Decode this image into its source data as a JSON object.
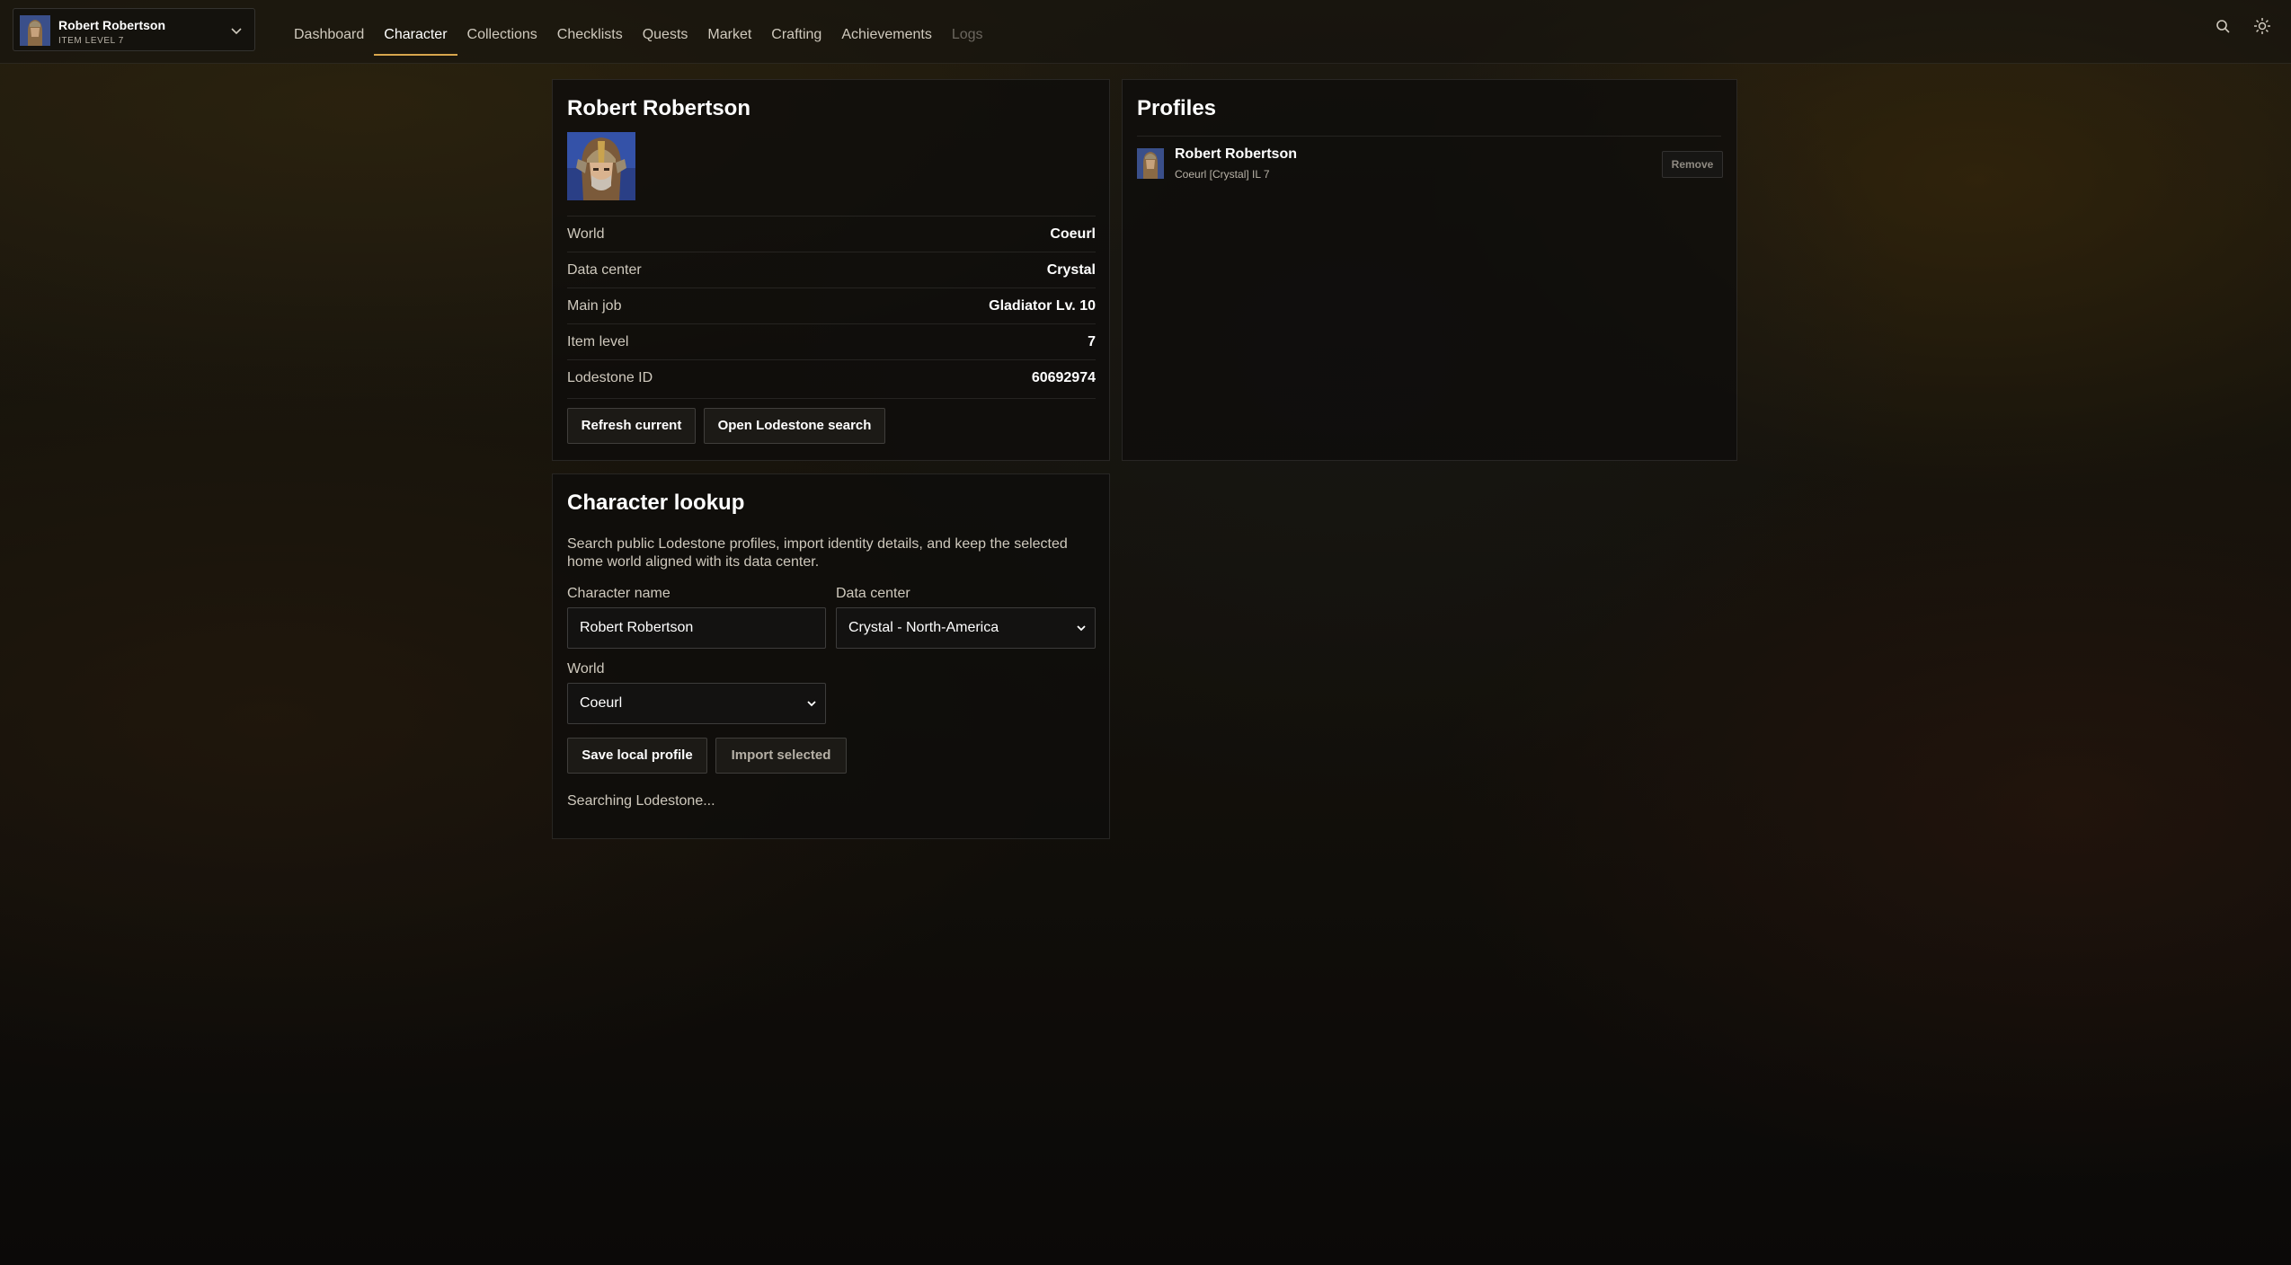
{
  "header": {
    "character_name": "Robert Robertson",
    "item_level_label": "ITEM LEVEL 7",
    "nav": [
      {
        "label": "Dashboard",
        "state": "normal"
      },
      {
        "label": "Character",
        "state": "active"
      },
      {
        "label": "Collections",
        "state": "normal"
      },
      {
        "label": "Checklists",
        "state": "normal"
      },
      {
        "label": "Quests",
        "state": "normal"
      },
      {
        "label": "Market",
        "state": "normal"
      },
      {
        "label": "Crafting",
        "state": "normal"
      },
      {
        "label": "Achievements",
        "state": "normal"
      },
      {
        "label": "Logs",
        "state": "disabled"
      }
    ],
    "icons": [
      "chevron-down-icon",
      "search-icon",
      "theme-sun-icon"
    ]
  },
  "character_card": {
    "title": "Robert Robertson",
    "details": [
      {
        "label": "World",
        "value": "Coeurl"
      },
      {
        "label": "Data center",
        "value": "Crystal"
      },
      {
        "label": "Main job",
        "value": "Gladiator Lv. 10"
      },
      {
        "label": "Item level",
        "value": "7"
      },
      {
        "label": "Lodestone ID",
        "value": "60692974"
      }
    ],
    "refresh_label": "Refresh current",
    "open_lodestone_label": "Open Lodestone search"
  },
  "profiles": {
    "title": "Profiles",
    "items": [
      {
        "name": "Robert Robertson",
        "subtitle": "Coeurl [Crystal] IL 7",
        "remove_label": "Remove"
      }
    ]
  },
  "lookup": {
    "title": "Character lookup",
    "description": "Search public Lodestone profiles, import identity details, and keep the selected home world aligned with its data center.",
    "name_label": "Character name",
    "name_value": "Robert Robertson",
    "dc_label": "Data center",
    "dc_value": "Crystal - North-America",
    "world_label": "World",
    "world_value": "Coeurl",
    "save_label": "Save local profile",
    "import_label": "Import selected",
    "status": "Searching Lodestone..."
  },
  "colors": {
    "accent": "#d8a64d",
    "panel_bg": "#0e0d0c",
    "text": "#e6e1d8"
  }
}
